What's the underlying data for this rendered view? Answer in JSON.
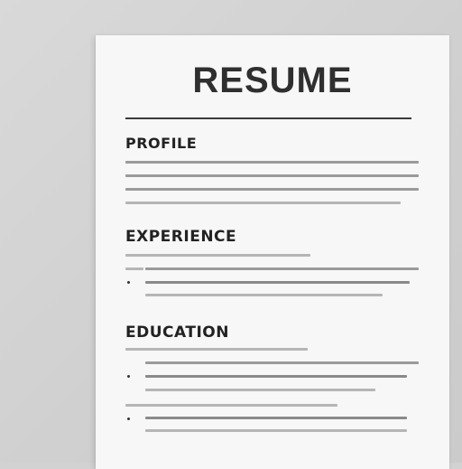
{
  "document": {
    "title": "RESUME",
    "sections": [
      {
        "heading": "PROFILE"
      },
      {
        "heading": "EXPERIENCE"
      },
      {
        "heading": "EDUCATION"
      }
    ]
  }
}
